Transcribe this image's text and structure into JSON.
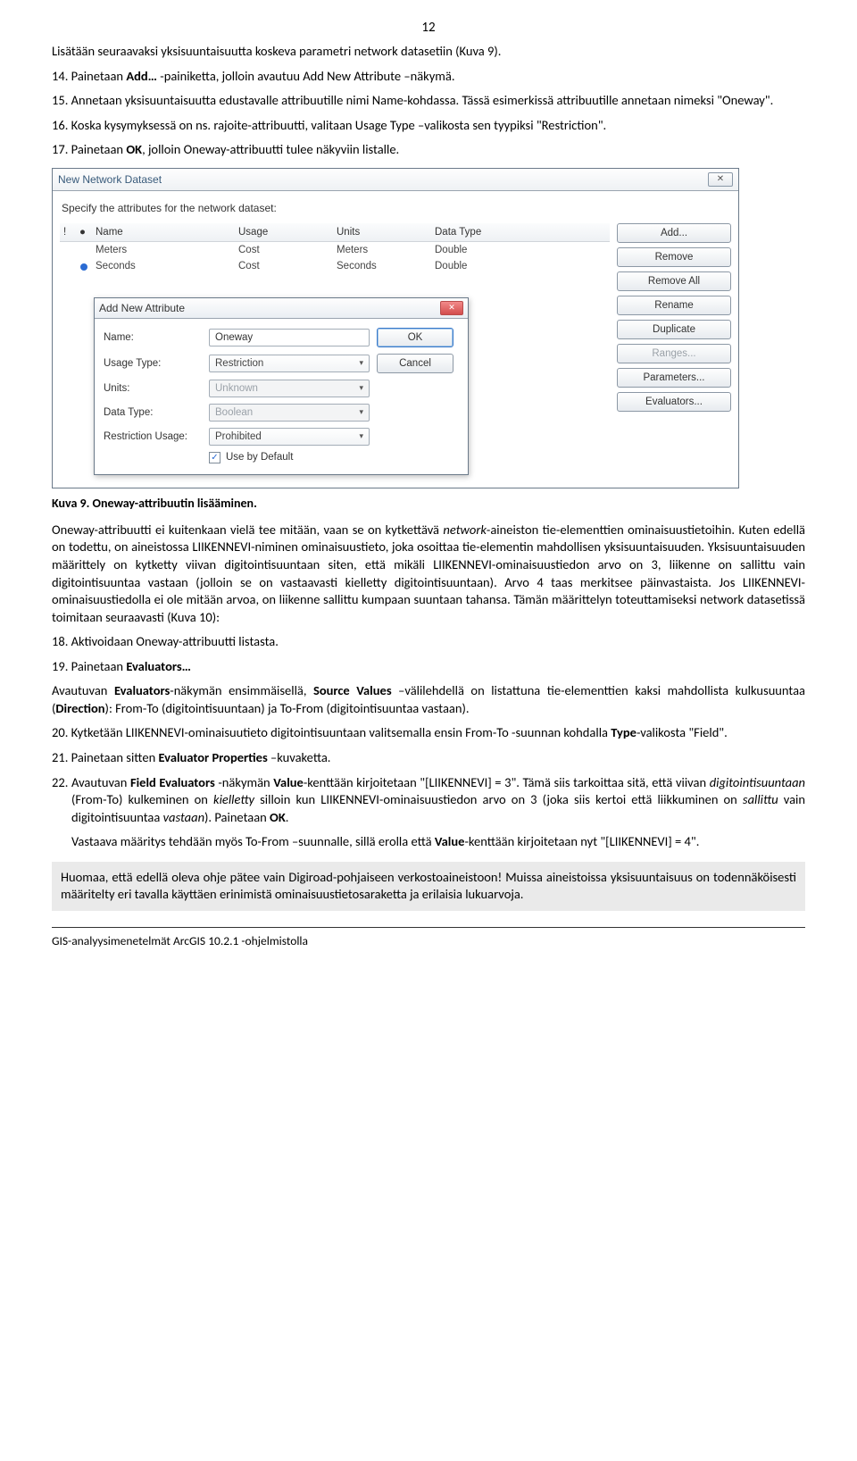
{
  "page_number": "12",
  "para_intro": "Lisätään seuraavaksi yksisuuntaisuutta koskeva parametri network datasetiin (Kuva 9).",
  "step14_a": "14. Painetaan ",
  "step14_b": "Add…",
  "step14_c": " -painiketta, jolloin avautuu Add New Attribute –näkymä.",
  "step15": "15. Annetaan yksisuuntaisuutta edustavalle attribuutille nimi Name-kohdassa. Tässä esimerkissä attribuutille annetaan nimeksi \"Oneway\".",
  "step16": "16. Koska kysymyksessä on ns. rajoite-attribuutti, valitaan Usage Type –valikosta sen tyypiksi \"Restriction\".",
  "step17_a": "17. Painetaan ",
  "step17_b": "OK",
  "step17_c": ", jolloin Oneway-attribuutti tulee näkyviin listalle.",
  "outer_dialog": {
    "title": "New Network Dataset",
    "prompt": "Specify the attributes for the network dataset:",
    "columns": {
      "c1": "!",
      "c2": "◉",
      "name": "Name",
      "usage": "Usage",
      "units": "Units",
      "datatype": "Data Type"
    },
    "rows": [
      {
        "name": "Meters",
        "usage": "Cost",
        "units": "Meters",
        "datatype": "Double"
      },
      {
        "name": "Seconds",
        "usage": "Cost",
        "units": "Seconds",
        "datatype": "Double"
      }
    ],
    "buttons": {
      "add": "Add...",
      "remove": "Remove",
      "remove_all": "Remove All",
      "rename": "Rename",
      "duplicate": "Duplicate",
      "ranges": "Ranges...",
      "parameters": "Parameters...",
      "evaluators": "Evaluators..."
    }
  },
  "modal": {
    "title": "Add New Attribute",
    "labels": {
      "name": "Name:",
      "usage": "Usage Type:",
      "units": "Units:",
      "datatype": "Data Type:",
      "rusage": "Restriction Usage:"
    },
    "values": {
      "name": "Oneway",
      "usage": "Restriction",
      "units": "Unknown",
      "datatype": "Boolean",
      "rusage": "Prohibited"
    },
    "ok": "OK",
    "cancel": "Cancel",
    "use_default": "Use by Default"
  },
  "caption9_a": "Kuva 9. Oneway-attribuutin lisääminen.",
  "para_mid_1": "Oneway-attribuutti ei kuitenkaan vielä tee mitään, vaan se on kytkettävä ",
  "para_mid_2": "network",
  "para_mid_3": "-aineiston tie-elementtien ominaisuustietoihin. Kuten edellä on todettu, on aineistossa LIIKENNEVI-niminen ominaisuustieto, joka osoittaa tie-elementin mahdollisen yksisuuntaisuuden. Yksisuuntaisuuden määrittely on kytketty viivan digitointisuuntaan siten, että mikäli LIIKENNEVI-ominaisuustiedon arvo on 3, liikenne on sallittu vain digitointisuuntaa vastaan (jolloin se on vastaavasti kielletty digitointisuuntaan). Arvo 4 taas merkitsee päinvastaista. Jos LIIKENNEVI-ominaisuustiedolla ei ole mitään arvoa, on liikenne sallittu kumpaan suuntaan tahansa. Tämän määrittelyn toteuttamiseksi network datasetissä toimitaan seuraavasti (Kuva 10):",
  "step18": "18. Aktivoidaan Oneway-attribuutti listasta.",
  "step19_a": "19. Painetaan ",
  "step19_b": "Evaluators…",
  "para_eval_1": "Avautuvan ",
  "para_eval_2": "Evaluators",
  "para_eval_3": "-näkymän ensimmäisellä, ",
  "para_eval_4": "Source Values",
  "para_eval_5": " –välilehdellä on listattuna tie-elementtien kaksi mahdollista kulkusuuntaa (",
  "para_eval_6": "Direction",
  "para_eval_7": "): From-To (digitointisuuntaan) ja To-From (digitointisuuntaa vastaan).",
  "step20_a": "20. Kytketään LIIKENNEVI-ominaisuutieto digitointisuuntaan valitsemalla ensin From-To -suunnan kohdalla ",
  "step20_b": "Type",
  "step20_c": "-valikosta \"Field\".",
  "step21_a": "21. Painetaan sitten ",
  "step21_b": "Evaluator Properties",
  "step21_c": " –kuvaketta.",
  "step22_a": "22. Avautuvan ",
  "step22_b": "Field Evaluators",
  "step22_c": " -näkymän ",
  "step22_d": "Value",
  "step22_e": "-kenttään kirjoitetaan \"[LIIKENNEVI] = 3\". Tämä siis tarkoittaa sitä, että viivan ",
  "step22_f": "digitointisuuntaan",
  "step22_g": " (From-To) kulkeminen on ",
  "step22_h": "kielletty",
  "step22_i": " silloin kun LIIKENNEVI-ominaisuustiedon arvo on 3 (joka siis kertoi että liikkuminen on ",
  "step22_j": "sallittu",
  "step22_k": " vain digitointisuuntaa ",
  "step22_l": "vastaan",
  "step22_m": "). Painetaan ",
  "step22_n": "OK",
  "step22_o": ".",
  "para_tofrom_a": "Vastaava määritys tehdään myös To-From –suunnalle, sillä erolla että ",
  "para_tofrom_b": "Value",
  "para_tofrom_c": "-kenttään kirjoitetaan nyt \"[LIIKENNEVI] = 4\".",
  "note": "Huomaa, että edellä oleva ohje pätee vain Digiroad-pohjaiseen verkostoaineistoon! Muissa aineistoissa yksisuuntaisuus on todennäköisesti määritelty eri tavalla käyttäen erinimistä ominaisuustietosaraketta ja erilaisia lukuarvoja.",
  "footer": "GIS-analyysimenetelmät ArcGIS 10.2.1 -ohjelmistolla"
}
